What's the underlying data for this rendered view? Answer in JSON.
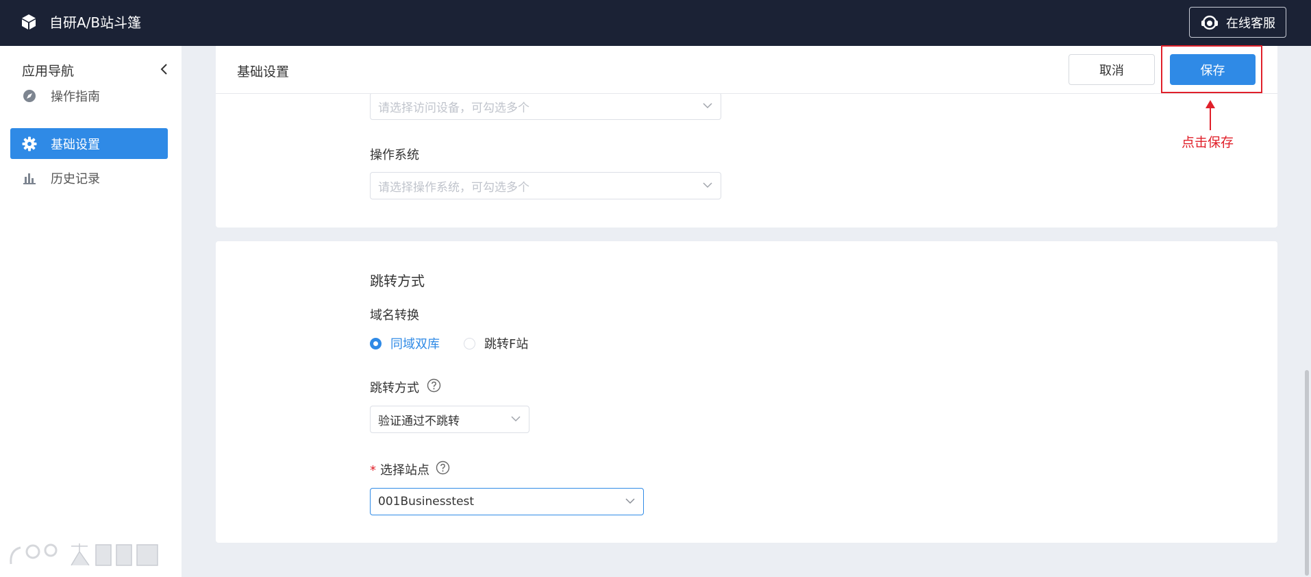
{
  "topbar": {
    "app_title": "自研A/B站斗篷",
    "support_label": "在线客服"
  },
  "sidebar": {
    "title": "应用导航",
    "items": [
      {
        "label": "操作指南",
        "icon": "compass-icon",
        "active": false
      },
      {
        "label": "基础设置",
        "icon": "gear-icon",
        "active": true
      },
      {
        "label": "历史记录",
        "icon": "bar-chart-icon",
        "active": false
      }
    ]
  },
  "header": {
    "title": "基础设置",
    "cancel_label": "取消",
    "save_label": "保存"
  },
  "annotation": {
    "text": "点击保存",
    "color": "#e0202a"
  },
  "device_section": {
    "device_placeholder": "请选择访问设备，可勾选多个",
    "os_label": "操作系统",
    "os_placeholder": "请选择操作系统，可勾选多个"
  },
  "redirect_section": {
    "title": "跳转方式",
    "domain_label": "域名转换",
    "domain_options": [
      {
        "label": "同域双库",
        "checked": true
      },
      {
        "label": "跳转F站",
        "checked": false
      }
    ],
    "mode_label": "跳转方式",
    "mode_value": "验证通过不跳转",
    "site_label": "选择站点",
    "site_required_mark": "*",
    "site_value": "001Businesstest"
  },
  "colors": {
    "topbar_bg": "#1b2235",
    "accent": "#2f8ae6",
    "page_bg": "#ebeef3"
  }
}
